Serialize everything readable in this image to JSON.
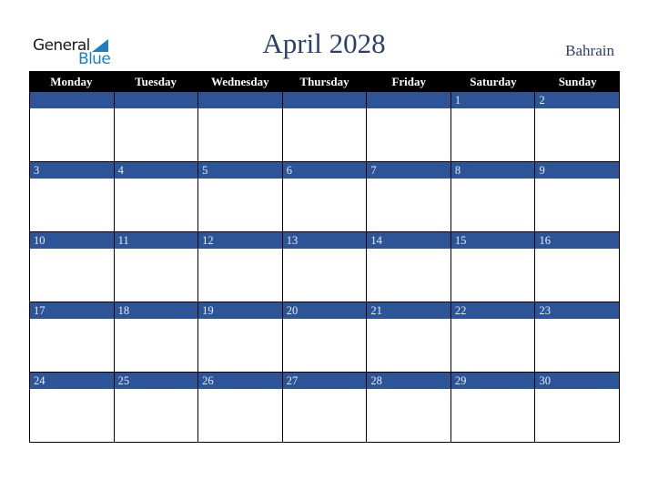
{
  "logo": {
    "general": "General",
    "blue": "Blue"
  },
  "title": "April 2028",
  "country": "Bahrain",
  "colors": {
    "header_bg": "#000000",
    "date_bar": "#2d5496",
    "title": "#2a3f6d",
    "logo_blue": "#1f7dc1"
  },
  "weekdays": [
    "Monday",
    "Tuesday",
    "Wednesday",
    "Thursday",
    "Friday",
    "Saturday",
    "Sunday"
  ],
  "weeks": [
    [
      "",
      "",
      "",
      "",
      "",
      "1",
      "2"
    ],
    [
      "3",
      "4",
      "5",
      "6",
      "7",
      "8",
      "9"
    ],
    [
      "10",
      "11",
      "12",
      "13",
      "14",
      "15",
      "16"
    ],
    [
      "17",
      "18",
      "19",
      "20",
      "21",
      "22",
      "23"
    ],
    [
      "24",
      "25",
      "26",
      "27",
      "28",
      "29",
      "30"
    ]
  ]
}
